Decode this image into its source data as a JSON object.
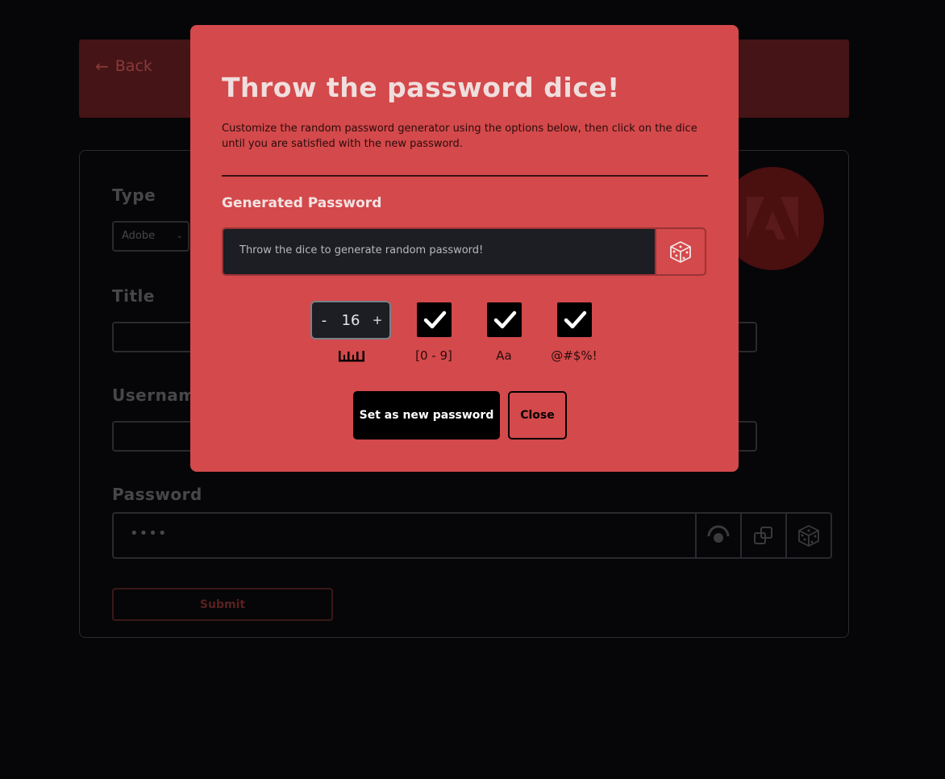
{
  "header": {
    "back_label": "Back"
  },
  "form": {
    "type_label": "Type",
    "type_value": "Adobe",
    "title_label": "Title",
    "username_label": "Username",
    "password_label": "Password",
    "password_value": "••••",
    "submit_label": "Submit"
  },
  "modal": {
    "title": "Throw the password dice!",
    "description": "Customize the random password generator using the options below, then click on the dice until you are satisfied with the new password.",
    "generated_label": "Generated Password",
    "generated_placeholder": "Throw the dice to generate random password!",
    "length": {
      "minus": "-",
      "value": "16",
      "plus": "+"
    },
    "options": [
      {
        "label": "[0 - 9]",
        "checked": true
      },
      {
        "label": "Aa",
        "checked": true
      },
      {
        "label": "@#$%!",
        "checked": true
      }
    ],
    "set_label": "Set as new password",
    "close_label": "Close"
  },
  "colors": {
    "modal_bg": "#d4494b",
    "page_bg": "#060608",
    "accent_dark": "#451416"
  }
}
